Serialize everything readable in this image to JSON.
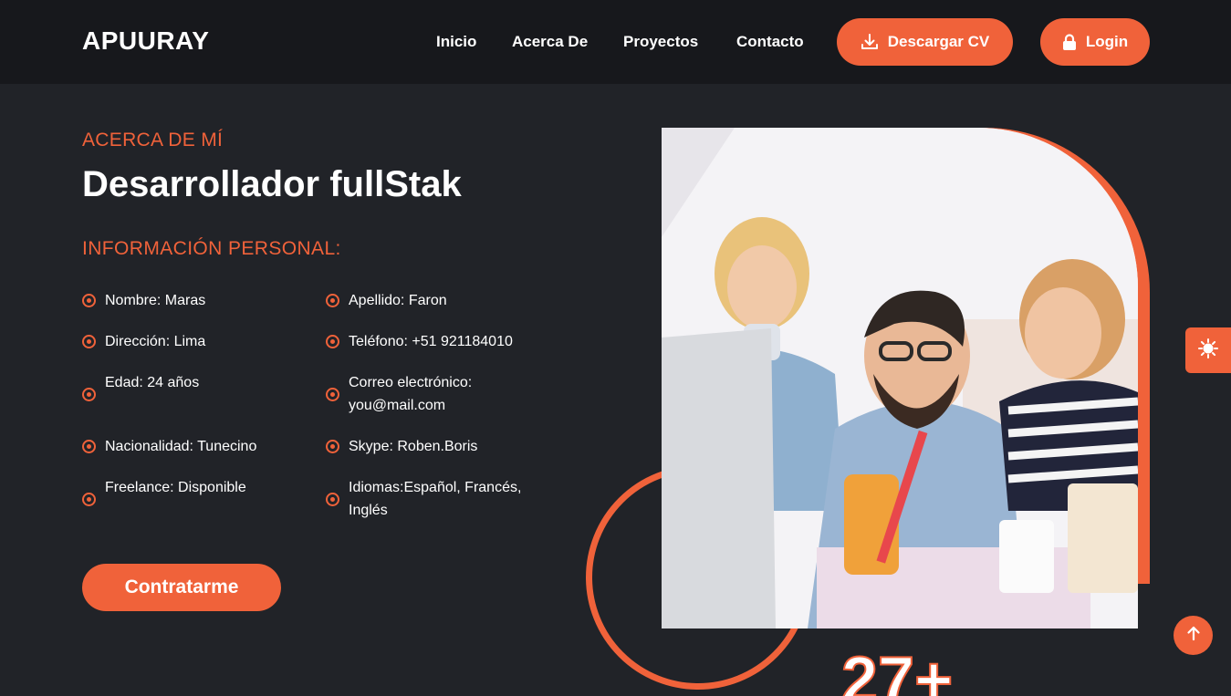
{
  "header": {
    "logo": "APUURAY",
    "nav": [
      "Inicio",
      "Acerca De",
      "Proyectos",
      "Contacto"
    ],
    "cv_button": "Descargar CV",
    "login_button": "Login"
  },
  "about": {
    "eyebrow": "ACERCA DE MÍ",
    "title": "Desarrollador fullStak",
    "subhead": "INFORMACIÓN PERSONAL:",
    "info": [
      "Nombre: Maras",
      "Apellido: Faron",
      "Dirección: Lima",
      "Teléfono: +51 921184010",
      "Edad: 24 años",
      "Correo electrónico: you@mail.com",
      "Nacionalidad: Tunecino",
      "Skype: Roben.Boris",
      "Freelance: Disponible",
      "Idiomas:Español, Francés, Inglés"
    ],
    "hire_button": "Contratarme",
    "counter": "27+"
  },
  "colors": {
    "accent": "#f0623a",
    "background": "#212328",
    "header": "#17181c"
  },
  "icons": {
    "cv": "download-icon",
    "login": "lock-icon",
    "theme": "sun-icon",
    "scroll": "arrow-up-icon",
    "bullet": "target-dot-icon"
  }
}
